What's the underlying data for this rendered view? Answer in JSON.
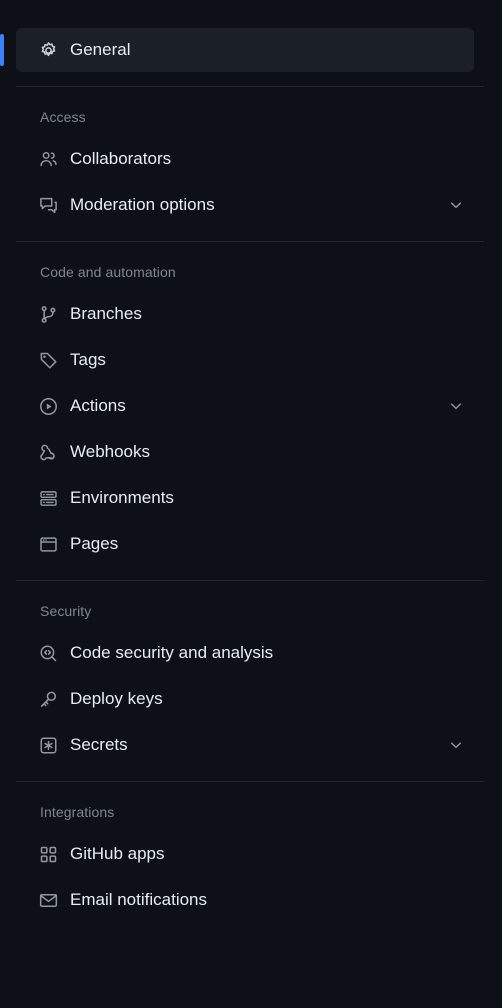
{
  "nav": {
    "aria_label": "Repository settings",
    "accent_color": "#3b82f6",
    "selected_background": "#1b2028",
    "page_background": "#0d1117",
    "groups": [
      {
        "title": "",
        "items": [
          {
            "label": "General",
            "icon": "gear-icon",
            "selected": true,
            "expandable": false
          }
        ]
      },
      {
        "title": "Access",
        "items": [
          {
            "label": "Collaborators",
            "icon": "people-icon",
            "selected": false,
            "expandable": false
          },
          {
            "label": "Moderation options",
            "icon": "comment-discussion-icon",
            "selected": false,
            "expandable": true
          }
        ]
      },
      {
        "title": "Code and automation",
        "items": [
          {
            "label": "Branches",
            "icon": "git-branch-icon",
            "selected": false,
            "expandable": false
          },
          {
            "label": "Tags",
            "icon": "tag-icon",
            "selected": false,
            "expandable": false
          },
          {
            "label": "Actions",
            "icon": "play-circle-icon",
            "selected": false,
            "expandable": true
          },
          {
            "label": "Webhooks",
            "icon": "webhook-icon",
            "selected": false,
            "expandable": false
          },
          {
            "label": "Environments",
            "icon": "server-icon",
            "selected": false,
            "expandable": false
          },
          {
            "label": "Pages",
            "icon": "browser-window-icon",
            "selected": false,
            "expandable": false
          }
        ]
      },
      {
        "title": "Security",
        "items": [
          {
            "label": "Code security and analysis",
            "icon": "code-scan-icon",
            "selected": false,
            "expandable": false
          },
          {
            "label": "Deploy keys",
            "icon": "key-icon",
            "selected": false,
            "expandable": false
          },
          {
            "label": "Secrets",
            "icon": "asterisk-square-icon",
            "selected": false,
            "expandable": true
          }
        ]
      },
      {
        "title": "Integrations",
        "items": [
          {
            "label": "GitHub apps",
            "icon": "apps-grid-icon",
            "selected": false,
            "expandable": false
          },
          {
            "label": "Email notifications",
            "icon": "mail-icon",
            "selected": false,
            "expandable": false
          }
        ]
      }
    ]
  }
}
